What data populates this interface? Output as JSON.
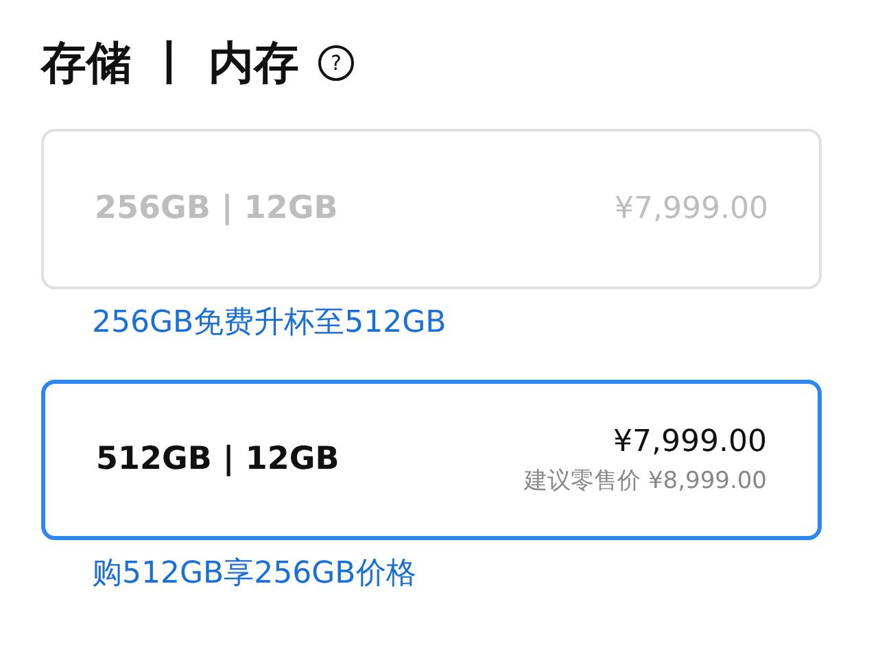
{
  "title": "存储 丨 内存",
  "help": "?",
  "options": [
    {
      "label": "256GB | 12GB",
      "price": "¥7,999.00",
      "selected": false,
      "disabled": true,
      "promo": "256GB免费升杯至512GB"
    },
    {
      "label": "512GB | 12GB",
      "price": "¥7,999.00",
      "list_price": "建议零售价 ¥8,999.00",
      "selected": true,
      "disabled": false,
      "promo": "购512GB享256GB价格"
    }
  ]
}
